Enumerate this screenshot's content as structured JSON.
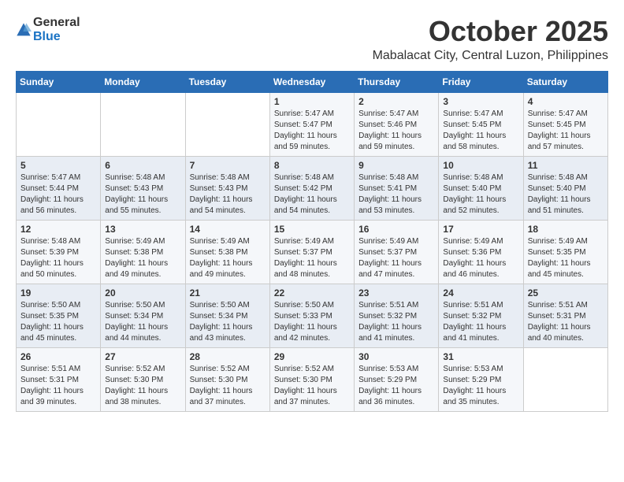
{
  "logo": {
    "general": "General",
    "blue": "Blue"
  },
  "header": {
    "month": "October 2025",
    "location": "Mabalacat City, Central Luzon, Philippines"
  },
  "weekdays": [
    "Sunday",
    "Monday",
    "Tuesday",
    "Wednesday",
    "Thursday",
    "Friday",
    "Saturday"
  ],
  "weeks": [
    [
      {
        "day": "",
        "sunrise": "",
        "sunset": "",
        "daylight": ""
      },
      {
        "day": "",
        "sunrise": "",
        "sunset": "",
        "daylight": ""
      },
      {
        "day": "",
        "sunrise": "",
        "sunset": "",
        "daylight": ""
      },
      {
        "day": "1",
        "sunrise": "Sunrise: 5:47 AM",
        "sunset": "Sunset: 5:47 PM",
        "daylight": "Daylight: 11 hours and 59 minutes."
      },
      {
        "day": "2",
        "sunrise": "Sunrise: 5:47 AM",
        "sunset": "Sunset: 5:46 PM",
        "daylight": "Daylight: 11 hours and 59 minutes."
      },
      {
        "day": "3",
        "sunrise": "Sunrise: 5:47 AM",
        "sunset": "Sunset: 5:45 PM",
        "daylight": "Daylight: 11 hours and 58 minutes."
      },
      {
        "day": "4",
        "sunrise": "Sunrise: 5:47 AM",
        "sunset": "Sunset: 5:45 PM",
        "daylight": "Daylight: 11 hours and 57 minutes."
      }
    ],
    [
      {
        "day": "5",
        "sunrise": "Sunrise: 5:47 AM",
        "sunset": "Sunset: 5:44 PM",
        "daylight": "Daylight: 11 hours and 56 minutes."
      },
      {
        "day": "6",
        "sunrise": "Sunrise: 5:48 AM",
        "sunset": "Sunset: 5:43 PM",
        "daylight": "Daylight: 11 hours and 55 minutes."
      },
      {
        "day": "7",
        "sunrise": "Sunrise: 5:48 AM",
        "sunset": "Sunset: 5:43 PM",
        "daylight": "Daylight: 11 hours and 54 minutes."
      },
      {
        "day": "8",
        "sunrise": "Sunrise: 5:48 AM",
        "sunset": "Sunset: 5:42 PM",
        "daylight": "Daylight: 11 hours and 54 minutes."
      },
      {
        "day": "9",
        "sunrise": "Sunrise: 5:48 AM",
        "sunset": "Sunset: 5:41 PM",
        "daylight": "Daylight: 11 hours and 53 minutes."
      },
      {
        "day": "10",
        "sunrise": "Sunrise: 5:48 AM",
        "sunset": "Sunset: 5:40 PM",
        "daylight": "Daylight: 11 hours and 52 minutes."
      },
      {
        "day": "11",
        "sunrise": "Sunrise: 5:48 AM",
        "sunset": "Sunset: 5:40 PM",
        "daylight": "Daylight: 11 hours and 51 minutes."
      }
    ],
    [
      {
        "day": "12",
        "sunrise": "Sunrise: 5:48 AM",
        "sunset": "Sunset: 5:39 PM",
        "daylight": "Daylight: 11 hours and 50 minutes."
      },
      {
        "day": "13",
        "sunrise": "Sunrise: 5:49 AM",
        "sunset": "Sunset: 5:38 PM",
        "daylight": "Daylight: 11 hours and 49 minutes."
      },
      {
        "day": "14",
        "sunrise": "Sunrise: 5:49 AM",
        "sunset": "Sunset: 5:38 PM",
        "daylight": "Daylight: 11 hours and 49 minutes."
      },
      {
        "day": "15",
        "sunrise": "Sunrise: 5:49 AM",
        "sunset": "Sunset: 5:37 PM",
        "daylight": "Daylight: 11 hours and 48 minutes."
      },
      {
        "day": "16",
        "sunrise": "Sunrise: 5:49 AM",
        "sunset": "Sunset: 5:37 PM",
        "daylight": "Daylight: 11 hours and 47 minutes."
      },
      {
        "day": "17",
        "sunrise": "Sunrise: 5:49 AM",
        "sunset": "Sunset: 5:36 PM",
        "daylight": "Daylight: 11 hours and 46 minutes."
      },
      {
        "day": "18",
        "sunrise": "Sunrise: 5:49 AM",
        "sunset": "Sunset: 5:35 PM",
        "daylight": "Daylight: 11 hours and 45 minutes."
      }
    ],
    [
      {
        "day": "19",
        "sunrise": "Sunrise: 5:50 AM",
        "sunset": "Sunset: 5:35 PM",
        "daylight": "Daylight: 11 hours and 45 minutes."
      },
      {
        "day": "20",
        "sunrise": "Sunrise: 5:50 AM",
        "sunset": "Sunset: 5:34 PM",
        "daylight": "Daylight: 11 hours and 44 minutes."
      },
      {
        "day": "21",
        "sunrise": "Sunrise: 5:50 AM",
        "sunset": "Sunset: 5:34 PM",
        "daylight": "Daylight: 11 hours and 43 minutes."
      },
      {
        "day": "22",
        "sunrise": "Sunrise: 5:50 AM",
        "sunset": "Sunset: 5:33 PM",
        "daylight": "Daylight: 11 hours and 42 minutes."
      },
      {
        "day": "23",
        "sunrise": "Sunrise: 5:51 AM",
        "sunset": "Sunset: 5:32 PM",
        "daylight": "Daylight: 11 hours and 41 minutes."
      },
      {
        "day": "24",
        "sunrise": "Sunrise: 5:51 AM",
        "sunset": "Sunset: 5:32 PM",
        "daylight": "Daylight: 11 hours and 41 minutes."
      },
      {
        "day": "25",
        "sunrise": "Sunrise: 5:51 AM",
        "sunset": "Sunset: 5:31 PM",
        "daylight": "Daylight: 11 hours and 40 minutes."
      }
    ],
    [
      {
        "day": "26",
        "sunrise": "Sunrise: 5:51 AM",
        "sunset": "Sunset: 5:31 PM",
        "daylight": "Daylight: 11 hours and 39 minutes."
      },
      {
        "day": "27",
        "sunrise": "Sunrise: 5:52 AM",
        "sunset": "Sunset: 5:30 PM",
        "daylight": "Daylight: 11 hours and 38 minutes."
      },
      {
        "day": "28",
        "sunrise": "Sunrise: 5:52 AM",
        "sunset": "Sunset: 5:30 PM",
        "daylight": "Daylight: 11 hours and 37 minutes."
      },
      {
        "day": "29",
        "sunrise": "Sunrise: 5:52 AM",
        "sunset": "Sunset: 5:30 PM",
        "daylight": "Daylight: 11 hours and 37 minutes."
      },
      {
        "day": "30",
        "sunrise": "Sunrise: 5:53 AM",
        "sunset": "Sunset: 5:29 PM",
        "daylight": "Daylight: 11 hours and 36 minutes."
      },
      {
        "day": "31",
        "sunrise": "Sunrise: 5:53 AM",
        "sunset": "Sunset: 5:29 PM",
        "daylight": "Daylight: 11 hours and 35 minutes."
      },
      {
        "day": "",
        "sunrise": "",
        "sunset": "",
        "daylight": ""
      }
    ]
  ]
}
